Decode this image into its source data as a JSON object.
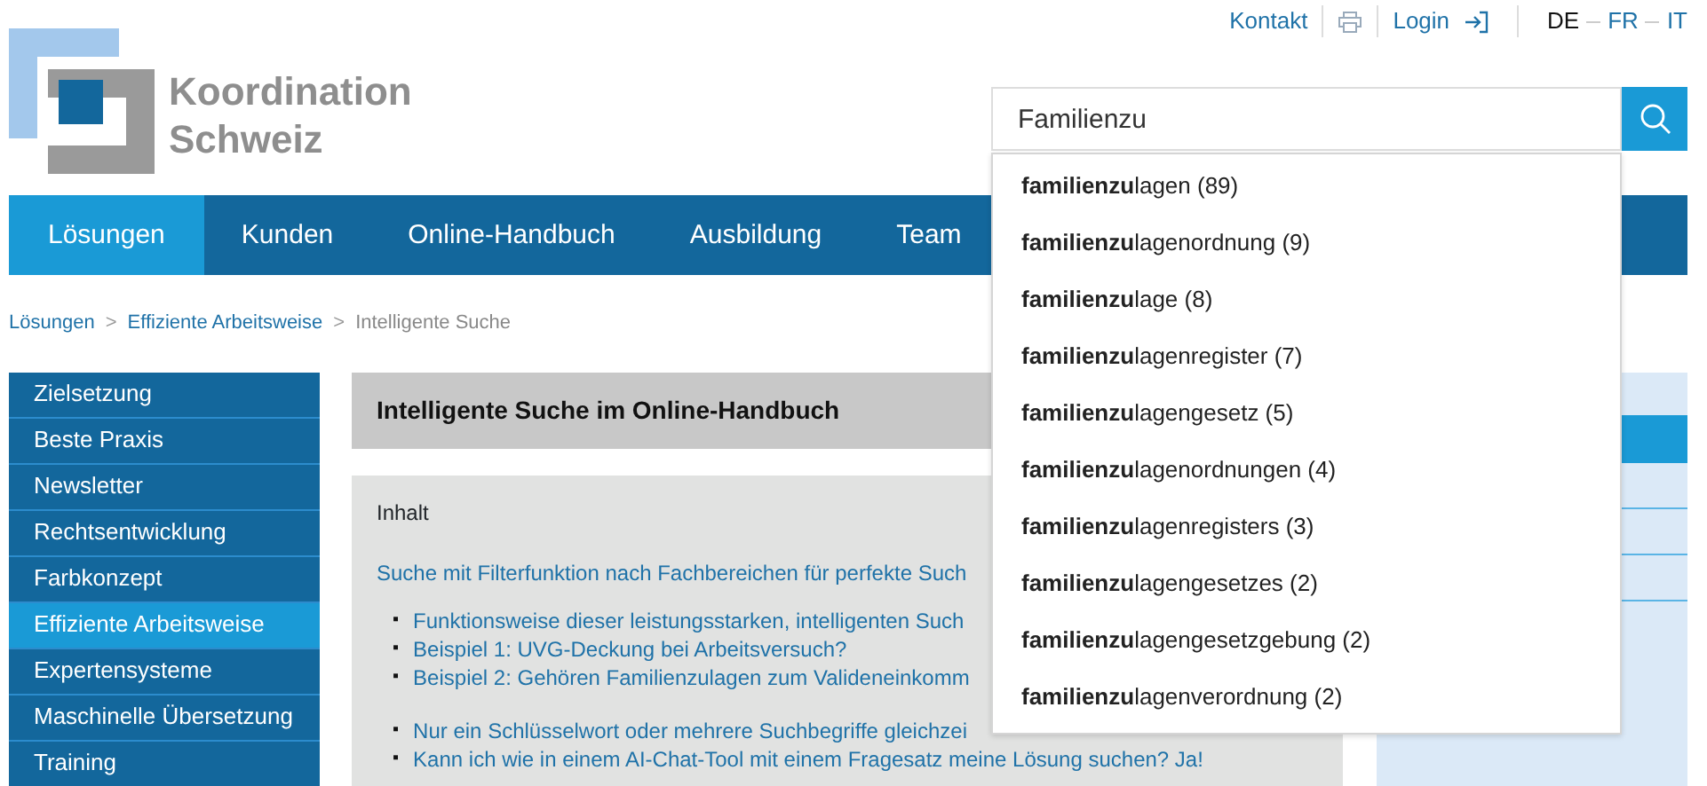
{
  "logo": {
    "line_1": "Koordination",
    "line_2": "Schweiz"
  },
  "top_links": {
    "contact": "Kontakt",
    "login": "Login"
  },
  "languages": [
    {
      "label": "DE",
      "selected": true
    },
    {
      "label": "FR",
      "selected": false
    },
    {
      "label": "IT",
      "selected": false
    }
  ],
  "search": {
    "value": "Familienzu"
  },
  "suggestions": [
    {
      "text": "**familienzu**lagen (89)"
    },
    {
      "text": "**familienzu**lagenordnung (9)"
    },
    {
      "text": "**familienzu**lage (8)"
    },
    {
      "text": "**familienzu**lagenregister (7)"
    },
    {
      "text": "**familienzu**lagengesetz (5)"
    },
    {
      "text": "**familienzu**lagenordnungen (4)"
    },
    {
      "text": "**familienzu**lagenregisters (3)"
    },
    {
      "text": "**familienzu**lagengesetzes (2)"
    },
    {
      "text": "**familienzu**lagengesetzgebung (2)"
    },
    {
      "text": "**familienzu**lagenverordnung (2)"
    }
  ],
  "nav": [
    {
      "label": "Lösungen",
      "selected": true
    },
    {
      "label": "Kunden",
      "selected": false
    },
    {
      "label": "Online-Handbuch",
      "selected": false
    },
    {
      "label": "Ausbildung",
      "selected": false
    },
    {
      "label": "Team",
      "selected": false
    }
  ],
  "breadcrumb": [
    {
      "label": "Lösungen",
      "kind": "link"
    },
    {
      "separator": ">",
      "label": "Effiziente Arbeitsweise",
      "kind": "link"
    },
    {
      "separator": ">",
      "label": "Intelligente Suche",
      "kind": "current"
    }
  ],
  "sidebar": {
    "items": [
      {
        "label": "Zielsetzung",
        "selected": false
      },
      {
        "label": "Beste Praxis",
        "selected": false
      },
      {
        "label": "Newsletter",
        "selected": false
      },
      {
        "label": "Rechtsentwicklung",
        "selected": false
      },
      {
        "label": "Farbkonzept",
        "selected": false
      },
      {
        "label": "Effiziente Arbeitsweise",
        "selected": true
      },
      {
        "label": "Expertensysteme",
        "selected": false
      },
      {
        "label": "Maschinelle Übersetzung",
        "selected": false
      },
      {
        "label": "Training",
        "selected": false
      }
    ]
  },
  "content": {
    "title": "Intelligente Suche im Online-Handbuch",
    "toc_heading": "Inhalt",
    "lead_link": "Suche mit Filterfunktion nach Fachbereichen für perfekte Such",
    "groups": [
      [
        {
          "marker": "▪",
          "text": "Funktionsweise dieser leistungsstarken, intelligenten Such"
        },
        {
          "marker": "▪",
          "text": "Beispiel 1: UVG-Deckung bei Arbeitsversuch?"
        },
        {
          "marker": "▪",
          "text": "Beispiel 2: Gehören Familienzulagen zum Valideneinkomm"
        }
      ],
      [
        {
          "marker": "▪",
          "text": "Nur ein Schlüsselwort oder mehrere Suchbegriffe gleichzei"
        },
        {
          "marker": "▪",
          "text": "Kann ich wie in einem AI-Chat-Tool mit einem Fragesatz meine Lösung suchen? Ja!"
        }
      ]
    ]
  }
}
